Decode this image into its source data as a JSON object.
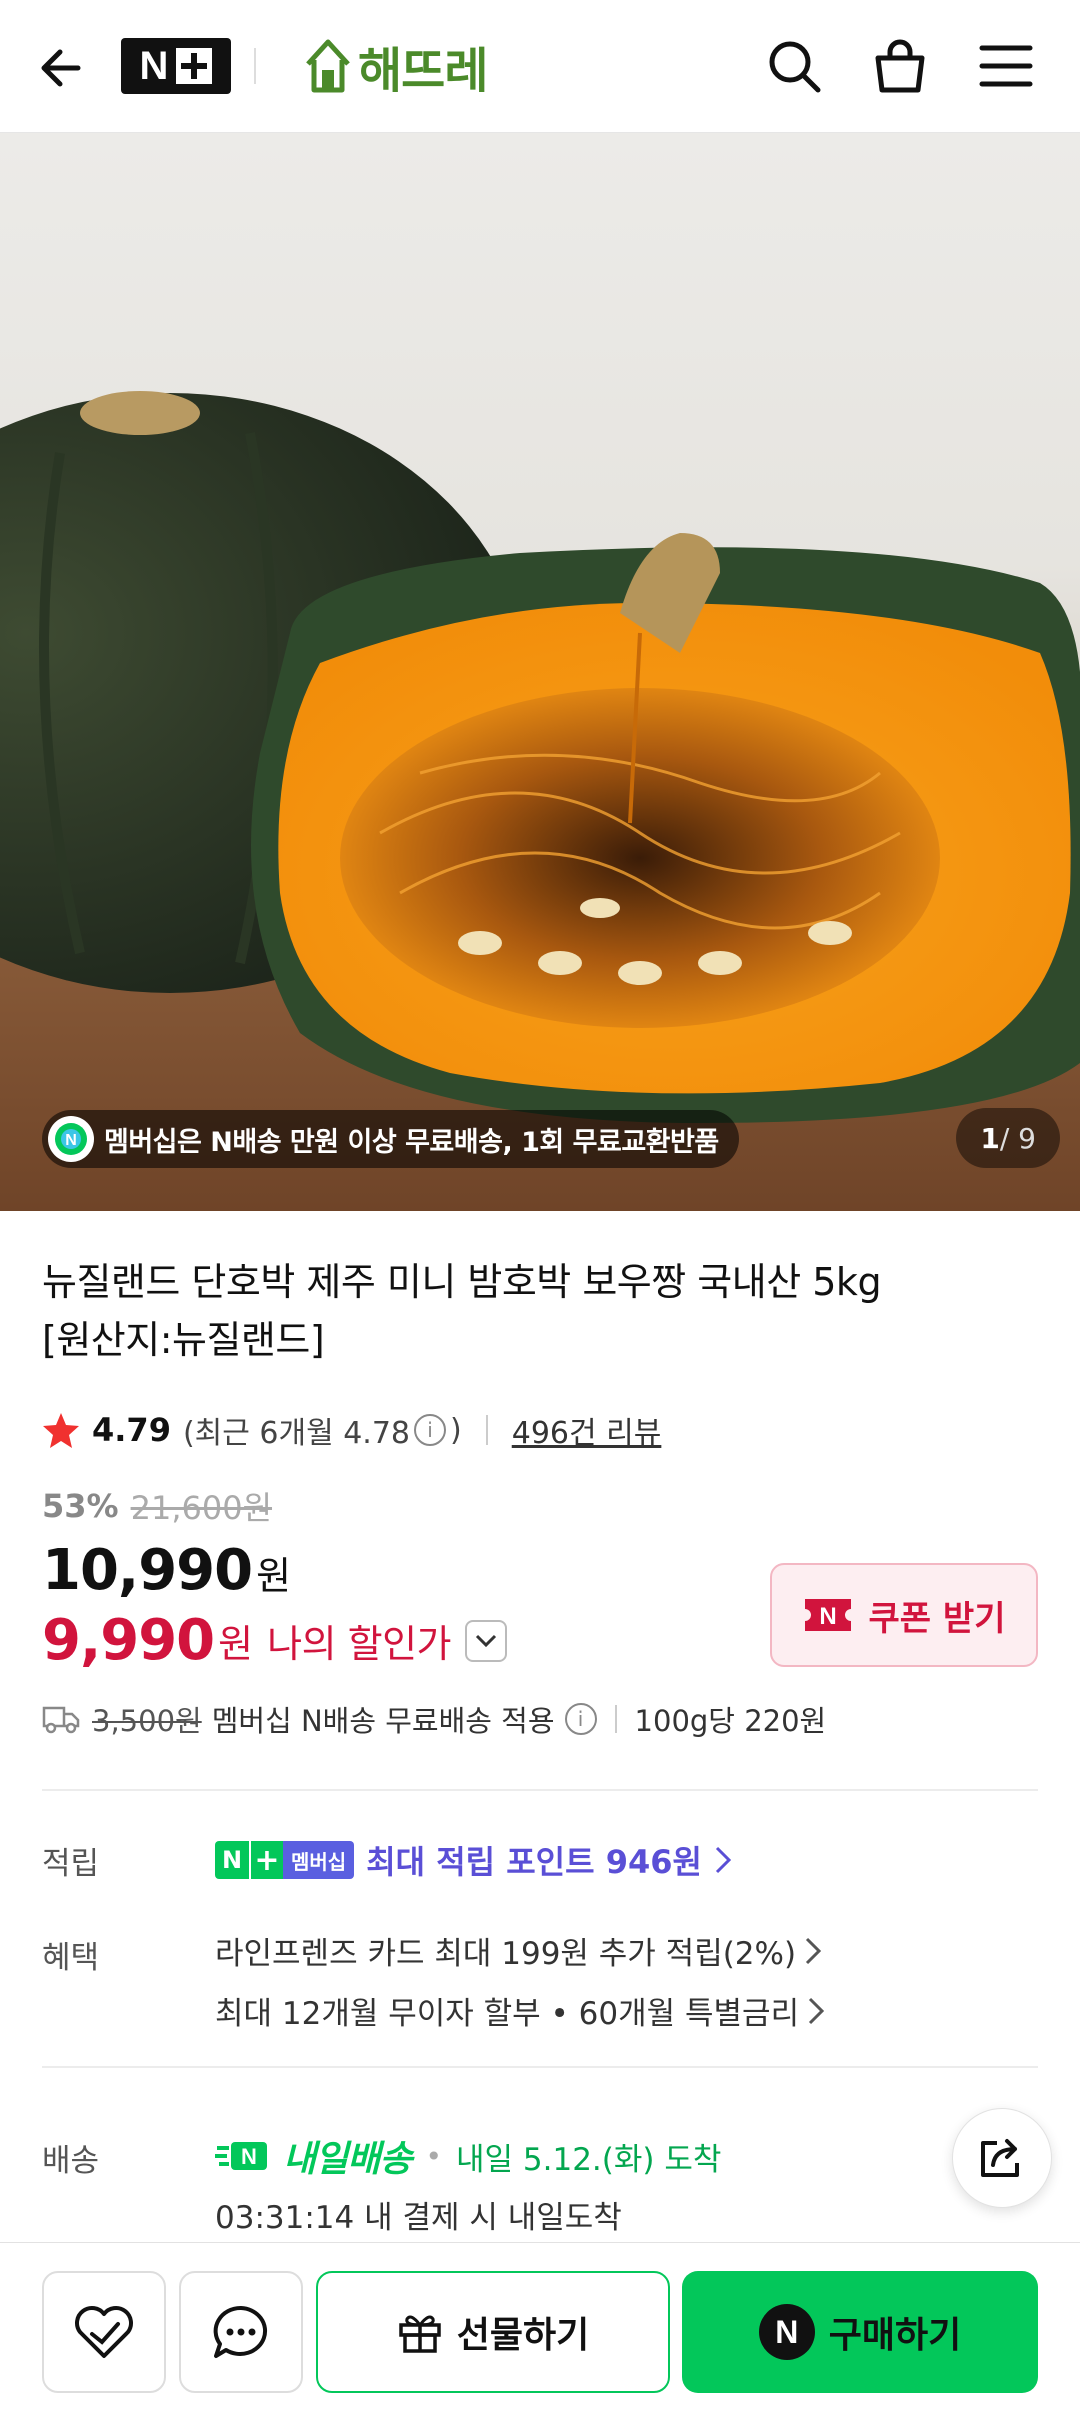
{
  "header": {
    "back_icon": "arrow-left-icon",
    "nplus_n": "N",
    "brand_name": "해뜨레",
    "search_icon": "search-icon",
    "cart_icon": "shopping-bag-icon",
    "menu_icon": "hamburger-menu-icon"
  },
  "hero": {
    "promo_text": "멤버십은 N배송 만원 이상 무료배송, 1회 무료교환반품",
    "page_current": "1",
    "page_total": "/ 9"
  },
  "product": {
    "title_line1": "뉴질랜드 단호박 제주 미니 밤호박 보우짱 국내산 5kg",
    "title_line2": "[원산지:뉴질랜드]",
    "rating": "4.79",
    "recent_rating_prefix": "(최근 6개월 4.78",
    "recent_rating_suffix": ")",
    "review_count": "496건 리뷰",
    "discount_pct": "53%",
    "original_price": "21,600원",
    "price": "10,990",
    "price_unit": "원",
    "my_price": "9,990",
    "my_price_unit": "원",
    "my_price_label": "나의 할인가",
    "coupon_label": "쿠폰 받기",
    "shipping_fee_original": "3,500원",
    "shipping_text": "멤버십 N배송 무료배송 적용",
    "unit_price": "100g당 220원"
  },
  "details": {
    "points_label": "적립",
    "membership_badge": "멤버십",
    "points_text": "최대 적립 포인트 946원",
    "benefit_label": "혜택",
    "benefit_1": "라인프렌즈 카드 최대 199원 추가 적립(2%)",
    "benefit_2": "최대 12개월 무이자 할부 • 60개월 특별금리",
    "delivery_label": "배송",
    "delivery_brand": "내일배송",
    "delivery_eta": "내일 5.12.(화) 도착",
    "countdown": "03:31:14  내 결제 시 내일도착"
  },
  "bottom": {
    "gift_label": "선물하기",
    "buy_label": "구매하기",
    "buy_badge": "N"
  },
  "colors": {
    "naver_green": "#03c75a",
    "price_red": "#d1143d",
    "points_purple": "#5a4fd6",
    "brand_green": "#4b8a2a"
  }
}
